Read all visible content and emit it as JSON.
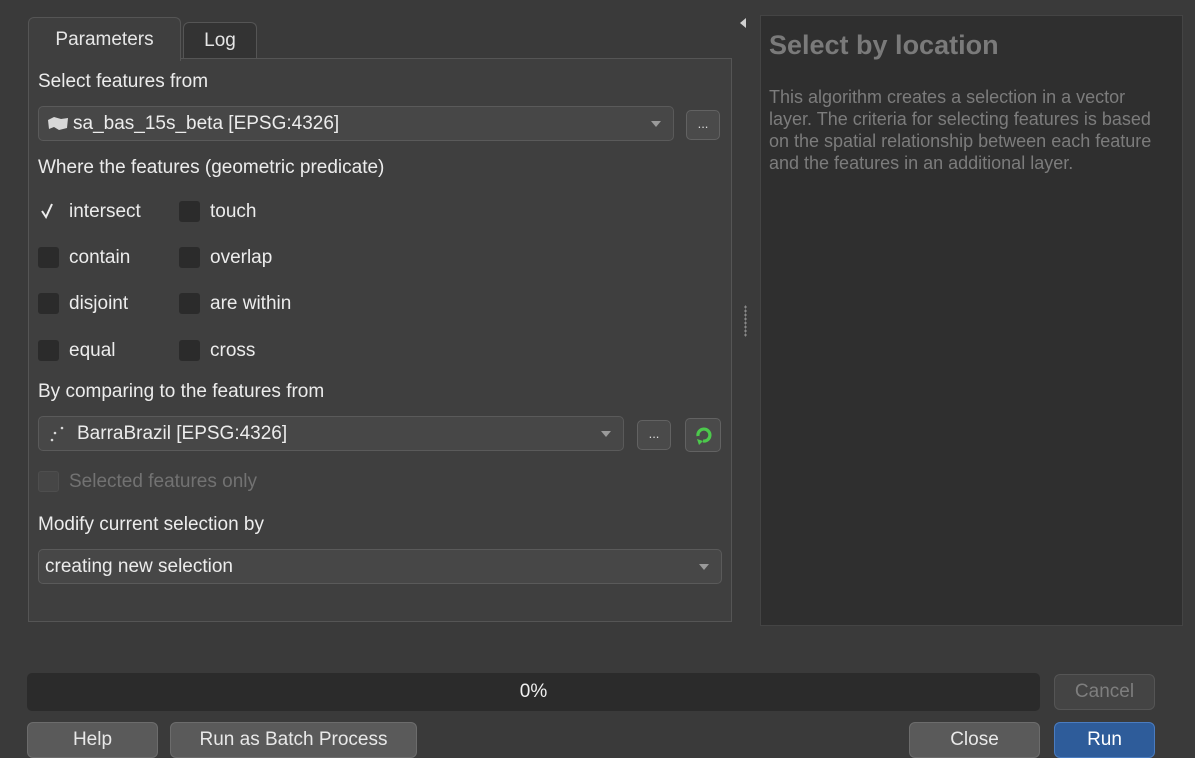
{
  "tabs": [
    {
      "label": "Parameters",
      "active": true
    },
    {
      "label": "Log",
      "active": false
    }
  ],
  "params": {
    "select_from_label": "Select features from",
    "input_layer": "sa_bas_15s_beta [EPSG:4326]",
    "predicate_label": "Where the features (geometric predicate)",
    "predicates": [
      {
        "label": "intersect",
        "checked": true
      },
      {
        "label": "touch",
        "checked": false
      },
      {
        "label": "contain",
        "checked": false
      },
      {
        "label": "overlap",
        "checked": false
      },
      {
        "label": "disjoint",
        "checked": false
      },
      {
        "label": "are within",
        "checked": false
      },
      {
        "label": "equal",
        "checked": false
      },
      {
        "label": "cross",
        "checked": false
      }
    ],
    "compare_label": "By comparing to the features from",
    "compare_layer": "BarraBrazil [EPSG:4326]",
    "selected_only_label": "Selected features only",
    "modify_label": "Modify current selection by",
    "modify_value": "creating new selection",
    "ellipsis": "..."
  },
  "help": {
    "title": "Select by location",
    "body": "This algorithm creates a selection in a vector layer. The criteria for selecting features is based on the spatial relationship between each feature and the features in an additional layer."
  },
  "progress": {
    "text": "0%",
    "value": 0
  },
  "buttons": {
    "cancel": "Cancel",
    "help": "Help",
    "batch": "Run as Batch Process",
    "close": "Close",
    "run": "Run"
  },
  "icons": {
    "polygon_layer": "polygon-layer-icon",
    "point_layer": "point-layer-icon",
    "iterate": "iterate-icon",
    "check": "checkmark-icon"
  }
}
